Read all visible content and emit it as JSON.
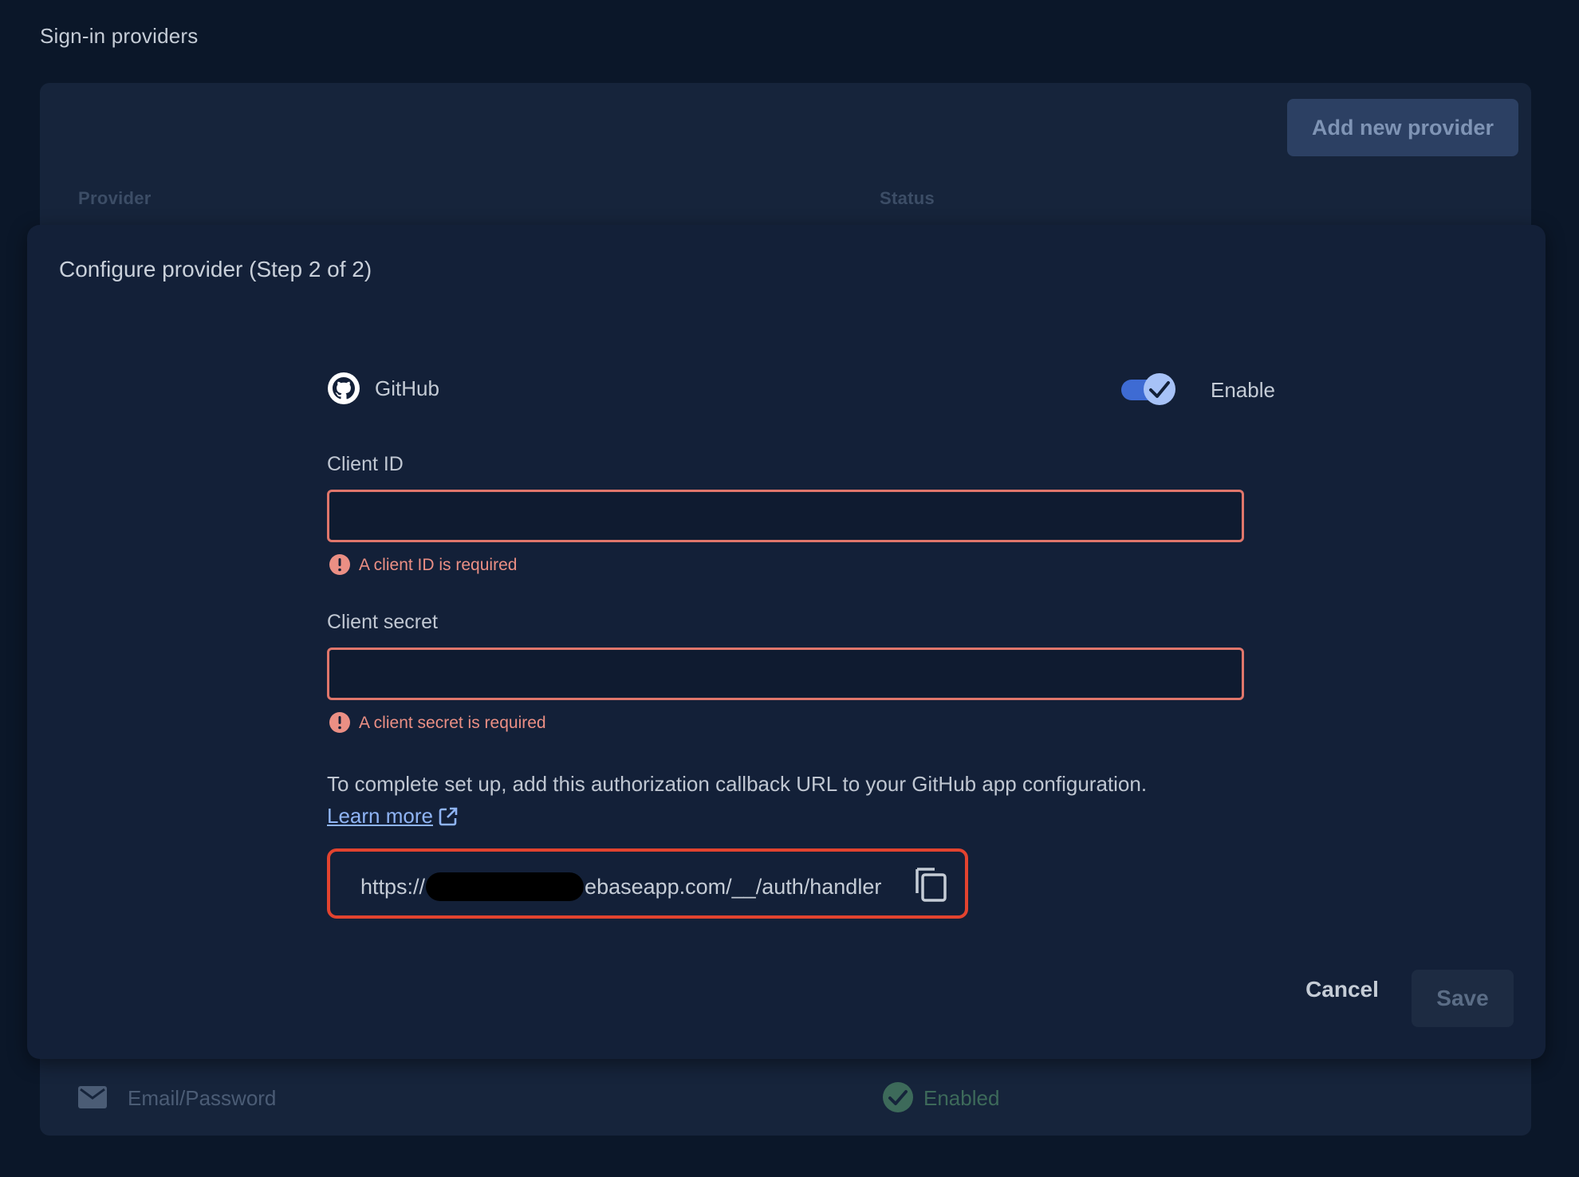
{
  "page": {
    "section_title": "Sign-in providers"
  },
  "providers_table": {
    "add_button_label": "Add new provider",
    "columns": [
      "Provider",
      "Status"
    ],
    "rows": [
      {
        "icon": "mail-icon",
        "provider": "Email/Password",
        "status_icon": "check-circle-icon",
        "status": "Enabled"
      }
    ]
  },
  "dialog": {
    "title": "Configure provider (Step 2 of 2)",
    "provider": {
      "icon": "github-icon",
      "name": "GitHub"
    },
    "enable_toggle": {
      "label": "Enable",
      "on": true
    },
    "fields": [
      {
        "label": "Client ID",
        "value": "",
        "error": "A client ID is required"
      },
      {
        "label": "Client secret",
        "value": "",
        "error": "A client secret is required"
      }
    ],
    "instructions": "To complete set up, add this authorization callback URL to your GitHub app configuration.",
    "learn_more_label": "Learn more",
    "callback_url": {
      "prefix": "https://",
      "suffix": "ebaseapp.com/__/auth/handler"
    },
    "cancel_label": "Cancel",
    "save_label": "Save"
  },
  "colors": {
    "error": "#e0766b",
    "highlight": "#e2432f",
    "accent": "#3e6bd3",
    "link": "#8fb4f5"
  }
}
